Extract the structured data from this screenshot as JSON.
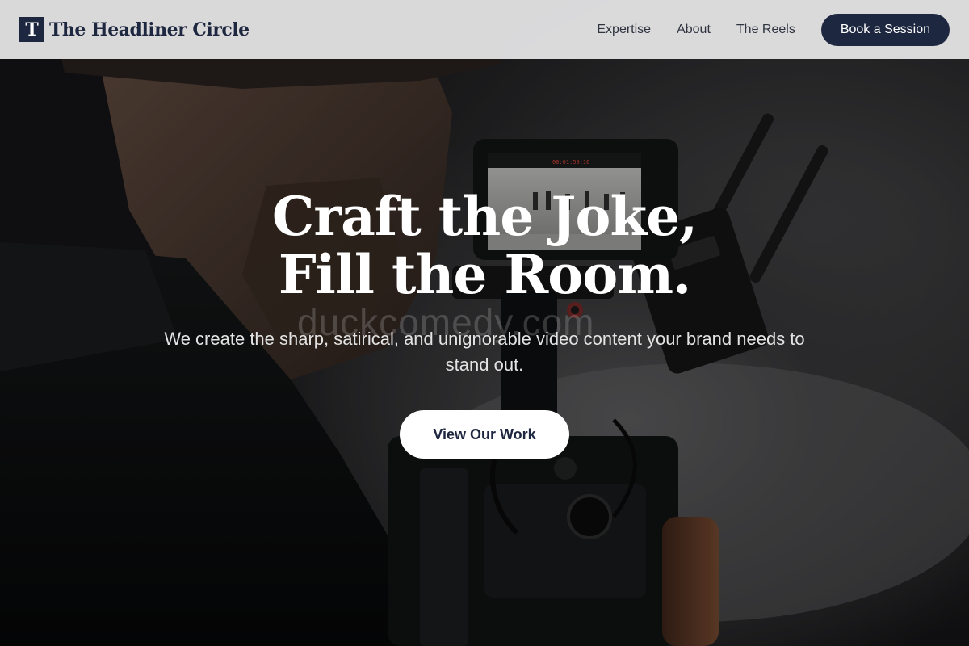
{
  "brand": {
    "mark": "T",
    "name": "The Headliner Circle"
  },
  "nav": {
    "links": [
      "Expertise",
      "About",
      "The Reels"
    ],
    "cta_label": "Book a Session"
  },
  "hero": {
    "headline_line1": "Craft the Joke,",
    "headline_line2": "Fill the Room.",
    "subhead": "We create the sharp, satirical, and unignorable video content your brand needs to stand out.",
    "cta_label": "View Our Work",
    "monitor_timecode": "00:01:59:16",
    "watermark": "duckcomedy.com"
  },
  "colors": {
    "navy": "#1e2740",
    "nav_bg": "#e8e8e9",
    "white": "#ffffff"
  },
  "icons": {
    "camera": "video-camera-photo",
    "brand": "letter-t-logo"
  }
}
